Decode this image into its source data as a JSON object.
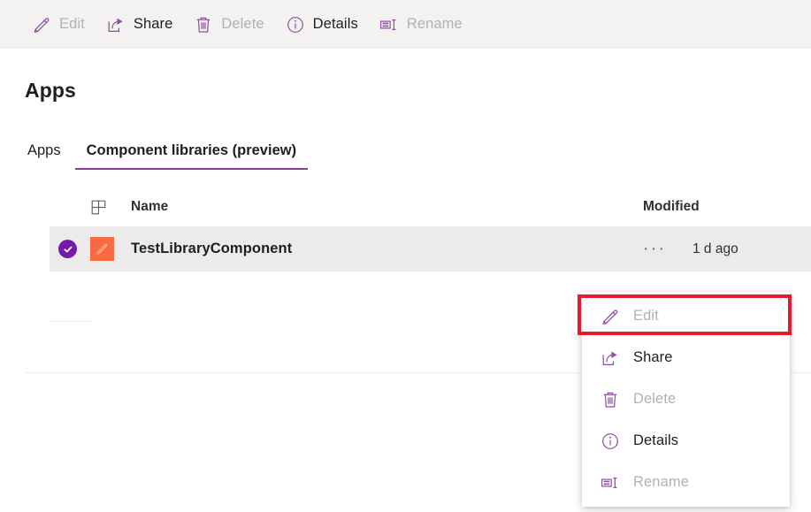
{
  "commandbar": {
    "items": [
      {
        "label": "Edit",
        "icon": "pencil-icon",
        "enabled": false
      },
      {
        "label": "Share",
        "icon": "share-icon",
        "enabled": true
      },
      {
        "label": "Delete",
        "icon": "trash-icon",
        "enabled": false
      },
      {
        "label": "Details",
        "icon": "info-icon",
        "enabled": true
      },
      {
        "label": "Rename",
        "icon": "rename-icon",
        "enabled": false
      }
    ]
  },
  "page": {
    "title": "Apps"
  },
  "tabs": [
    {
      "label": "Apps",
      "active": false
    },
    {
      "label": "Component libraries (preview)",
      "active": true
    }
  ],
  "list": {
    "columns": {
      "icon": "component-grid-icon",
      "name": "Name",
      "modified": "Modified"
    },
    "rows": [
      {
        "selected": true,
        "check_icon": "checkmark-circle-icon",
        "app_icon": "pencil-app-tile-icon",
        "name": "TestLibraryComponent",
        "overflow": "···",
        "modified": "1 d ago"
      }
    ]
  },
  "context_menu": {
    "items": [
      {
        "label": "Edit",
        "icon": "pencil-icon",
        "enabled": false,
        "highlighted": true
      },
      {
        "label": "Share",
        "icon": "share-icon",
        "enabled": true,
        "highlighted": false
      },
      {
        "label": "Delete",
        "icon": "trash-icon",
        "enabled": false,
        "highlighted": false
      },
      {
        "label": "Details",
        "icon": "info-icon",
        "enabled": true,
        "highlighted": false
      },
      {
        "label": "Rename",
        "icon": "rename-icon",
        "enabled": false,
        "highlighted": false
      }
    ]
  },
  "colors": {
    "accent_purple": "#8c3b96",
    "icon_purple": "#8e4f9e",
    "selection_purple": "#7719aa",
    "app_tile_orange": "#f96a42",
    "highlight_red": "#e8192c",
    "commandbar_bg": "#f3f2f1",
    "row_selected_bg": "#edebe9",
    "disabled_text": "#b4b2b0"
  }
}
